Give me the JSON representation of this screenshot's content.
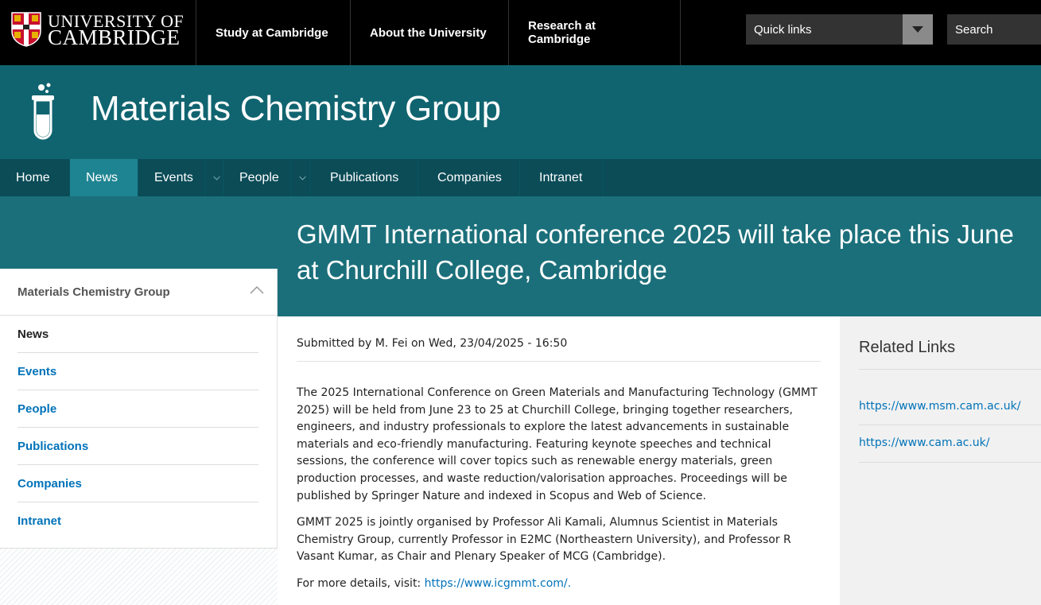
{
  "header": {
    "university_line1": "UNIVERSITY OF",
    "university_line2": "CAMBRIDGE",
    "top_links": [
      "Study at Cambridge",
      "About the University",
      "Research at Cambridge"
    ],
    "quick_links_label": "Quick links",
    "search_label": "Search"
  },
  "site": {
    "title": "Materials Chemistry Group"
  },
  "nav": {
    "items": [
      {
        "label": "Home"
      },
      {
        "label": "News"
      },
      {
        "label": "Events"
      },
      {
        "label": "People"
      },
      {
        "label": "Publications"
      },
      {
        "label": "Companies"
      },
      {
        "label": "Intranet"
      }
    ]
  },
  "page": {
    "title": "GMMT International conference 2025 will take place this June at Churchill College, Cambridge",
    "submitted": "Submitted by M. Fei on Wed, 23/04/2025 - 16:50",
    "para1": "The 2025 International Conference on Green Materials and Manufacturing Technology (GMMT 2025) will be held from June 23 to 25 at Churchill College, bringing together researchers, engineers, and industry professionals to explore the latest advancements in sustainable materials and eco-friendly manufacturing. Featuring keynote speeches and technical sessions, the conference will cover topics such as renewable energy materials, green production processes, and waste reduction/valorisation approaches. Proceedings will be published by Springer Nature and indexed in Scopus and Web of Science.",
    "para2": "GMMT 2025 is jointly organised by Professor Ali Kamali, Alumnus Scientist in Materials Chemistry Group, currently Professor in E2MC (Northeastern University), and Professor R Vasant Kumar, as Chair and Plenary Speaker of MCG (Cambridge).",
    "details_prefix": "For more details, visit: ",
    "details_link": "https://www.icgmmt.com/."
  },
  "sidebar": {
    "heading": "Materials Chemistry Group",
    "items": [
      {
        "label": "News"
      },
      {
        "label": "Events"
      },
      {
        "label": "People"
      },
      {
        "label": "Publications"
      },
      {
        "label": "Companies"
      },
      {
        "label": "Intranet"
      }
    ]
  },
  "related": {
    "title": "Related Links",
    "links": [
      "https://www.msm.cam.ac.uk/",
      "https://www.cam.ac.uk/"
    ]
  }
}
